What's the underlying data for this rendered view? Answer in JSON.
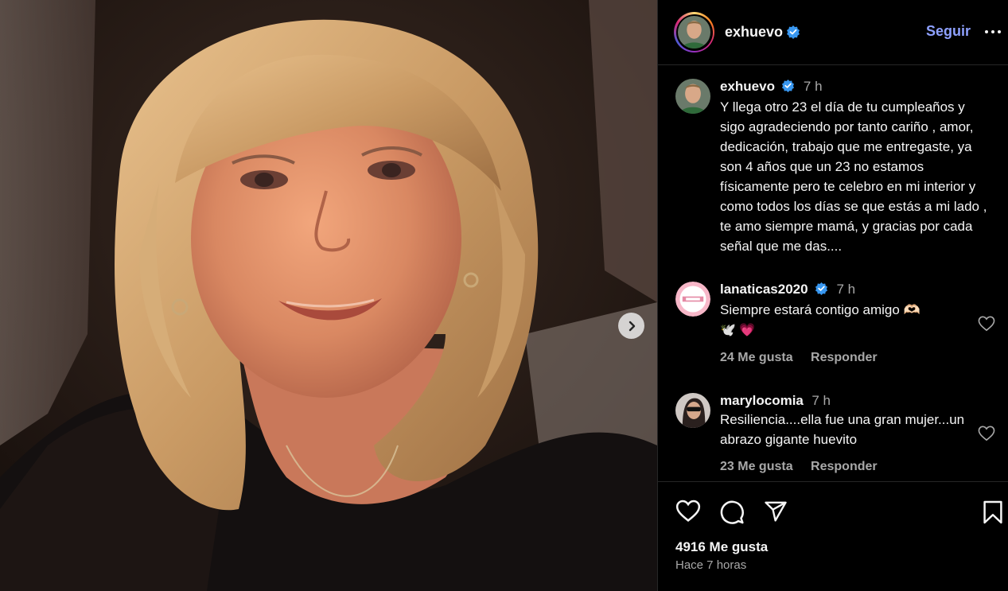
{
  "post": {
    "image_alt": "Fotografía de una mujer de cabello rubio sonriendo",
    "next_icon": "chevron-right-icon"
  },
  "header": {
    "username": "exhuevo",
    "follow_label": "Seguir",
    "more_icon": "more-horizontal-icon"
  },
  "caption": {
    "username": "exhuevo",
    "time": "7 h",
    "text": "Y llega otro 23 el día de tu cumpleaños y sigo agradeciendo por tanto cariño , amor, dedicación, trabajo que me entregaste, ya son 4 años que un 23 no estamos físicamente pero te celebro en mi interior y como todos los días se que estás a mi lado , te amo siempre mamá, y gracias por cada señal que me das...."
  },
  "comments": [
    {
      "username": "lanaticas2020",
      "verified": true,
      "time": "7 h",
      "text": "Siempre estará contigo amigo 🫶🏻",
      "text_line2": "🕊️ 💗",
      "likes": "24 Me gusta",
      "reply_label": "Responder"
    },
    {
      "username": "marylocomia",
      "verified": false,
      "time": "7 h",
      "text": "Resiliencia....ella fue una gran mujer...un abrazo gigante huevito",
      "likes": "23 Me gusta",
      "reply_label": "Responder"
    }
  ],
  "actions": {
    "like_icon": "heart-icon",
    "comment_icon": "comment-icon",
    "share_icon": "send-icon",
    "save_icon": "bookmark-icon",
    "likes_count": "4916 Me gusta",
    "posted": "Hace 7 horas"
  },
  "colors": {
    "background": "#000000",
    "link": "#8ea1ff",
    "verified": "#3897f0",
    "secondary_text": "#a8a8a8",
    "divider": "#262626"
  }
}
